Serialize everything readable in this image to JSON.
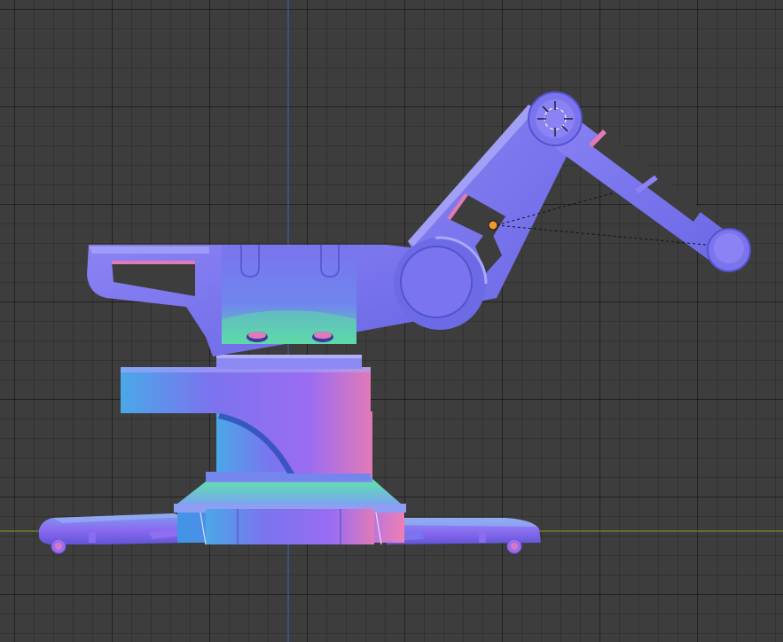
{
  "viewport": {
    "view": "orthographic-front",
    "shading": "normal-map-matcap",
    "background_color": "#3d3d3d",
    "axes": {
      "x_axis_color": "#6f8f2d",
      "z_axis_color": "#3e63a8"
    }
  },
  "scene": {
    "object": "robotic-arm",
    "parts": [
      "base",
      "feet",
      "column",
      "turntable-housing",
      "shoulder-joint",
      "upper-arm",
      "elbow-joint",
      "forearm",
      "wrist-joint"
    ],
    "icons": {
      "light": "light-empty-icon",
      "origin": "origin-dot-icon"
    },
    "colors": {
      "normal_blue": "#7a74ee",
      "normal_violet": "#9a6cf2",
      "normal_pink": "#e07ab8",
      "normal_green": "#55e0b0",
      "normal_cyan": "#4aa8e8",
      "origin": "#f29a2e",
      "selection_outline": "#f0f0f0"
    }
  }
}
